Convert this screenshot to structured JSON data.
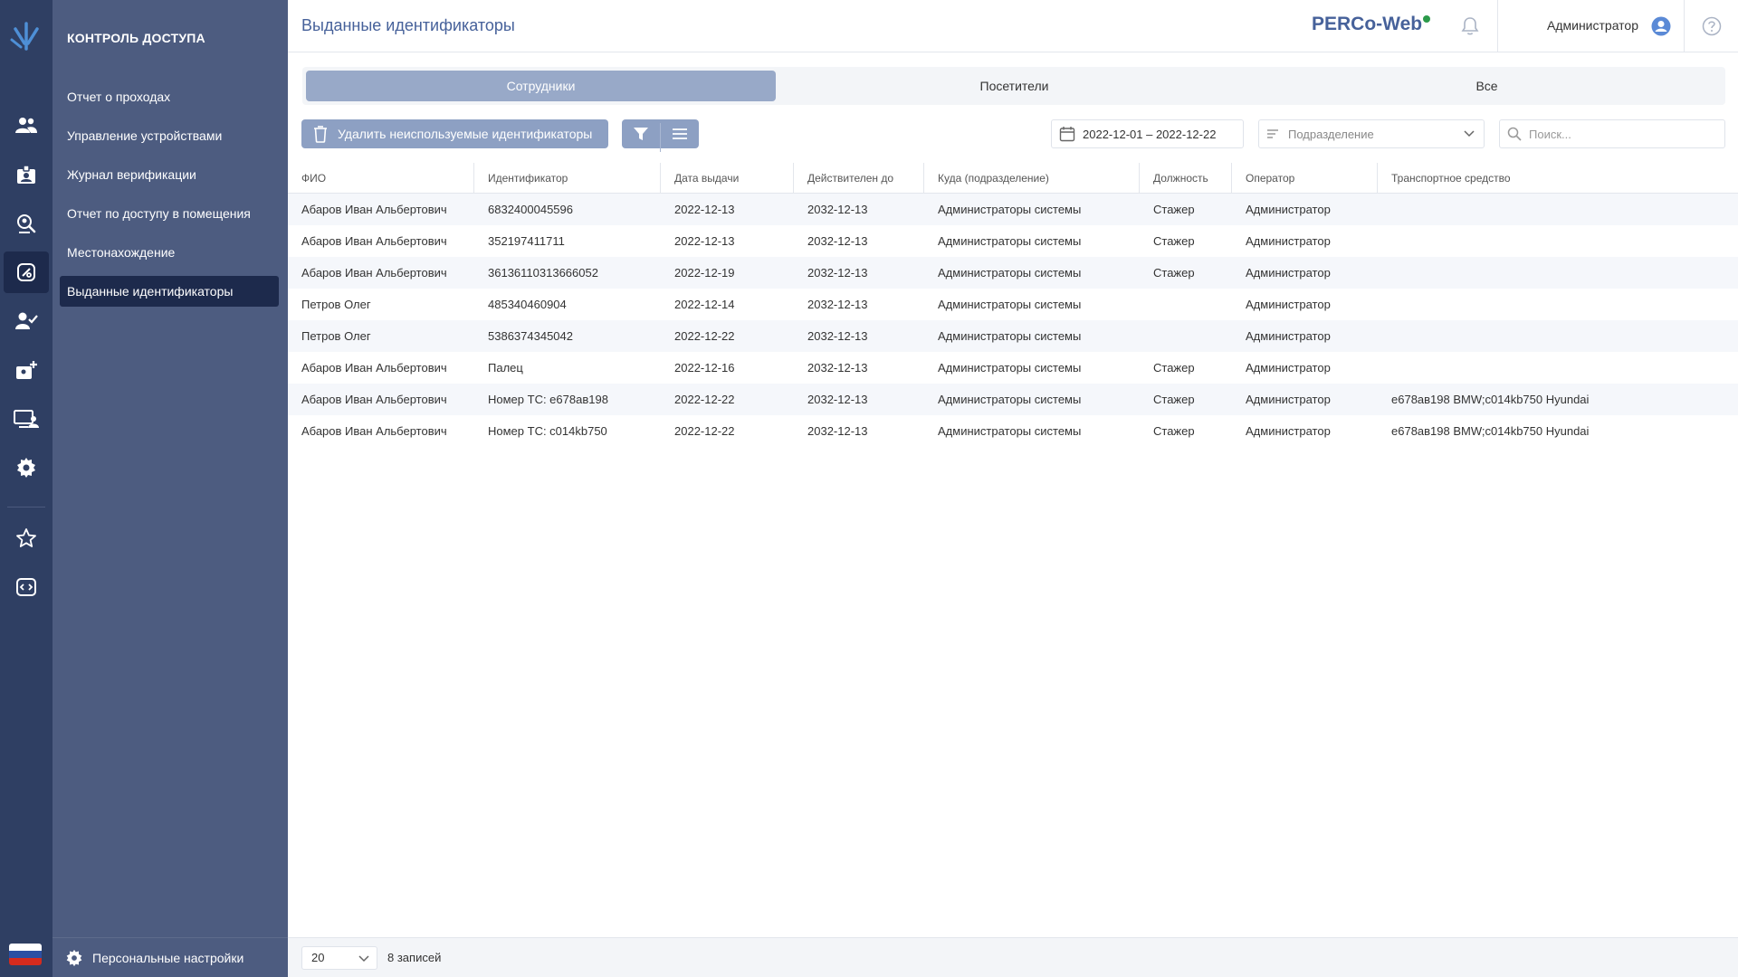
{
  "header": {
    "title": "Выданные идентификаторы",
    "brand": "PERCo-Web",
    "user": "Администратор"
  },
  "sidebar": {
    "section_title": "КОНТРОЛЬ ДОСТУПА",
    "items": [
      {
        "label": "Отчет о проходах"
      },
      {
        "label": "Управление устройствами"
      },
      {
        "label": "Журнал верификации"
      },
      {
        "label": "Отчет по доступу в помещения"
      },
      {
        "label": "Местонахождение"
      },
      {
        "label": "Выданные идентификаторы",
        "active": true
      }
    ],
    "personal_settings": "Персональные настройки"
  },
  "tabs": [
    {
      "label": "Сотрудники",
      "active": true
    },
    {
      "label": "Посетители"
    },
    {
      "label": "Все"
    }
  ],
  "toolbar": {
    "delete_label": "Удалить неиспользуемые идентификаторы",
    "date_range": "2022-12-01 – 2022-12-22",
    "department_placeholder": "Подразделение",
    "search_placeholder": "Поиск..."
  },
  "table": {
    "columns": [
      "ФИО",
      "Идентификатор",
      "Дата выдачи",
      "Действителен до",
      "Куда (подразделение)",
      "Должность",
      "Оператор",
      "Транспортное средство"
    ],
    "rows": [
      [
        "Абаров Иван Альбертович",
        "6832400045596",
        "2022-12-13",
        "2032-12-13",
        "Администраторы системы",
        "Стажер",
        "Администратор",
        ""
      ],
      [
        "Абаров Иван Альбертович",
        "352197411711",
        "2022-12-13",
        "2032-12-13",
        "Администраторы системы",
        "Стажер",
        "Администратор",
        ""
      ],
      [
        "Абаров Иван Альбертович",
        "36136110313666052",
        "2022-12-19",
        "2032-12-13",
        "Администраторы системы",
        "Стажер",
        "Администратор",
        ""
      ],
      [
        "Петров Олег",
        "485340460904",
        "2022-12-14",
        "2032-12-13",
        "Администраторы системы",
        "",
        "Администратор",
        ""
      ],
      [
        "Петров Олег",
        "5386374345042",
        "2022-12-22",
        "2032-12-13",
        "Администраторы системы",
        "",
        "Администратор",
        ""
      ],
      [
        "Абаров Иван Альбертович",
        "Палец",
        "2022-12-16",
        "2032-12-13",
        "Администраторы системы",
        "Стажер",
        "Администратор",
        ""
      ],
      [
        "Абаров Иван Альбертович",
        "Номер ТС: е678ав198",
        "2022-12-22",
        "2032-12-13",
        "Администраторы системы",
        "Стажер",
        "Администратор",
        "е678ав198 BMW;с014kb750 Hyundai"
      ],
      [
        "Абаров Иван Альбертович",
        "Номер ТС: с014kb750",
        "2022-12-22",
        "2032-12-13",
        "Администраторы системы",
        "Стажер",
        "Администратор",
        "е678ав198 BMW;с014kb750 Hyundai"
      ]
    ]
  },
  "footer": {
    "page_size": "20",
    "records": "8 записей"
  },
  "icons": {
    "rail": [
      "people-icon",
      "badge-icon",
      "access-icon",
      "identifier-icon",
      "user-check-icon",
      "add-badge-icon",
      "monitor-user-icon",
      "gear-icon",
      "star-icon",
      "code-icon"
    ]
  },
  "colors": {
    "rail_bg": "#2f3f63",
    "nav_bg": "#4d5c80",
    "active_bg": "#1d2a4c",
    "accent": "#46619a",
    "button": "#8da0c3"
  }
}
